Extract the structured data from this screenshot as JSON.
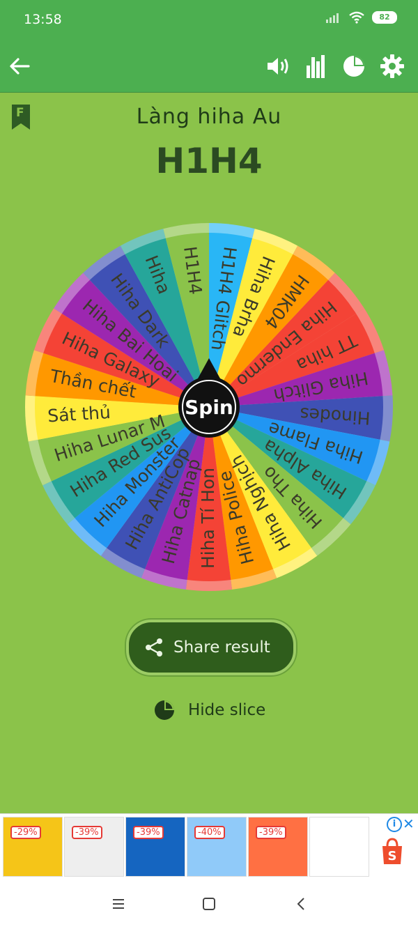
{
  "status": {
    "time": "13:58",
    "battery": "82"
  },
  "header": {
    "back_icon": "arrow-left-icon",
    "actions": [
      "volume-icon",
      "stats-icon",
      "pie-icon",
      "settings-icon"
    ]
  },
  "main": {
    "bookmark_letter": "F",
    "subtitle": "Làng hiha Au",
    "title": "H1H4",
    "spin_label": "Spin",
    "share_label": "Share result",
    "hide_label": "Hide slice"
  },
  "wheel": {
    "slices": [
      {
        "label": "H1H4 Glitch",
        "color": "#29b6f6"
      },
      {
        "label": "Hiha Brha",
        "color": "#ffeb3b"
      },
      {
        "label": "HMK04",
        "color": "#ff9800"
      },
      {
        "label": "Hiha Endermo",
        "color": "#f44336"
      },
      {
        "label": "TT hiha",
        "color": "#f44336"
      },
      {
        "label": "Hiha Glitch",
        "color": "#9c27b0"
      },
      {
        "label": "Hinodes",
        "color": "#3f51b5"
      },
      {
        "label": "Hiha Flame",
        "color": "#2196f3"
      },
      {
        "label": "Hiha Alpha",
        "color": "#26a69a"
      },
      {
        "label": "Hiha Tho",
        "color": "#8bc34a"
      },
      {
        "label": "Hiha Nghịch",
        "color": "#ffeb3b"
      },
      {
        "label": "Hiha Police",
        "color": "#ff9800"
      },
      {
        "label": "Hiha Tí Hon",
        "color": "#f44336"
      },
      {
        "label": "Hiha Catnap",
        "color": "#9c27b0"
      },
      {
        "label": "Hiha AntiCop",
        "color": "#3f51b5"
      },
      {
        "label": "Hiha Monster",
        "color": "#2196f3"
      },
      {
        "label": "Hiha Red Sus",
        "color": "#26a69a"
      },
      {
        "label": "Hiha Lunar M",
        "color": "#8bc34a"
      },
      {
        "label": "Sát thủ",
        "color": "#ffeb3b"
      },
      {
        "label": "Thần chết",
        "color": "#ff9800"
      },
      {
        "label": "Hiha Galaxy",
        "color": "#f44336"
      },
      {
        "label": "Hiha Bai Hoai",
        "color": "#9c27b0"
      },
      {
        "label": "Hiha Dark",
        "color": "#3f51b5"
      },
      {
        "label": "Hiha",
        "color": "#26a69a"
      },
      {
        "label": "H1H4",
        "color": "#8bc34a"
      }
    ]
  },
  "ads": [
    {
      "badge": "-29%",
      "color": "#f5c518"
    },
    {
      "badge": "-39%",
      "color": "#eeeeee"
    },
    {
      "badge": "-39%",
      "color": "#1565c0"
    },
    {
      "badge": "-40%",
      "color": "#90caf9"
    },
    {
      "badge": "-39%",
      "color": "#ff7043"
    },
    {
      "badge": "",
      "color": "#ffffff"
    }
  ],
  "nav": {
    "icons": [
      "menu-icon",
      "home-icon",
      "back-icon"
    ]
  }
}
